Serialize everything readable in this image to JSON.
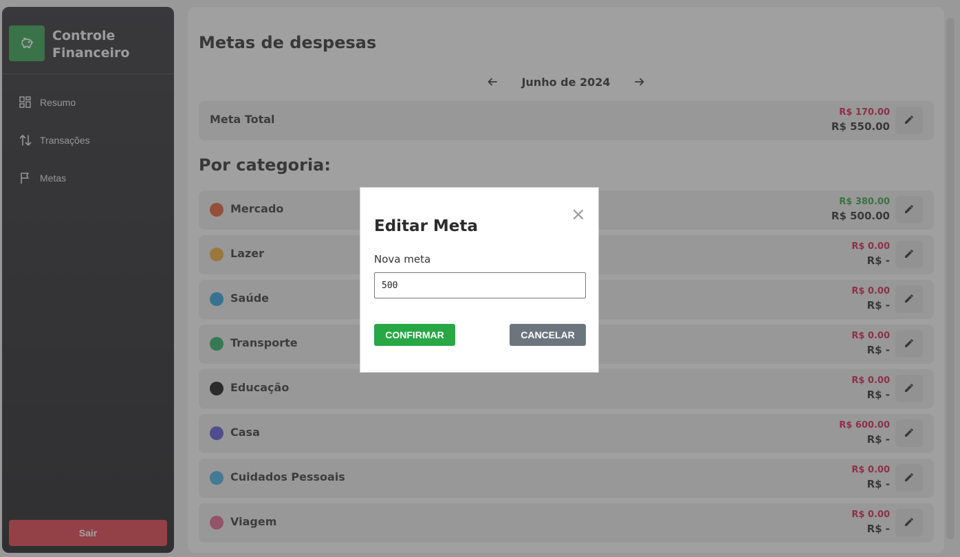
{
  "app": {
    "title": "Controle Financeiro",
    "brand_icon": "piggy-bank-icon"
  },
  "sidebar": {
    "items": [
      {
        "label": "Resumo",
        "icon": "dashboard-grid-icon"
      },
      {
        "label": "Transações",
        "icon": "swap-vertical-arrows-icon"
      },
      {
        "label": "Metas",
        "icon": "flag-icon"
      }
    ],
    "logout_label": "Sair"
  },
  "page": {
    "title": "Metas de despesas",
    "month_label": "Junho de 2024",
    "prev_icon": "arrow-left-icon",
    "next_icon": "arrow-right-icon"
  },
  "total": {
    "label": "Meta Total",
    "spent": "R$ 170.00",
    "target": "R$ 550.00",
    "spent_color": "#d6184b"
  },
  "categories_title": "Por categoria:",
  "categories": [
    {
      "name": "Mercado",
      "color": "#e4572e",
      "spent": "R$ 380.00",
      "target": "R$ 500.00",
      "spent_color": "#2e9e3e"
    },
    {
      "name": "Lazer",
      "color": "#f0a830",
      "spent": "R$ 0.00",
      "target": "R$ -",
      "spent_color": "#d6184b"
    },
    {
      "name": "Saúde",
      "color": "#2a9fe0",
      "spent": "R$ 0.00",
      "target": "R$ -",
      "spent_color": "#d6184b"
    },
    {
      "name": "Transporte",
      "color": "#27ae60",
      "spent": "R$ 0.00",
      "target": "R$ -",
      "spent_color": "#d6184b"
    },
    {
      "name": "Educação",
      "color": "#111111",
      "spent": "R$ 0.00",
      "target": "R$ -",
      "spent_color": "#d6184b"
    },
    {
      "name": "Casa",
      "color": "#5b55d6",
      "spent": "R$ 600.00",
      "target": "R$ -",
      "spent_color": "#d6184b"
    },
    {
      "name": "Cuidados Pessoais",
      "color": "#3fb0e0",
      "spent": "R$ 0.00",
      "target": "R$ -",
      "spent_color": "#d6184b"
    },
    {
      "name": "Viagem",
      "color": "#e0608a",
      "spent": "R$ 0.00",
      "target": "R$ -",
      "spent_color": "#d6184b"
    }
  ],
  "modal": {
    "title": "Editar Meta",
    "close_symbol": "×",
    "field_label": "Nova meta",
    "field_value": "500",
    "confirm_label": "CONFIRMAR",
    "cancel_label": "CANCELAR"
  },
  "colors": {
    "brand_green": "#2fa04a",
    "logout_red": "#e23b48",
    "confirm_green": "#28a745",
    "cancel_gray": "#6c757d"
  }
}
